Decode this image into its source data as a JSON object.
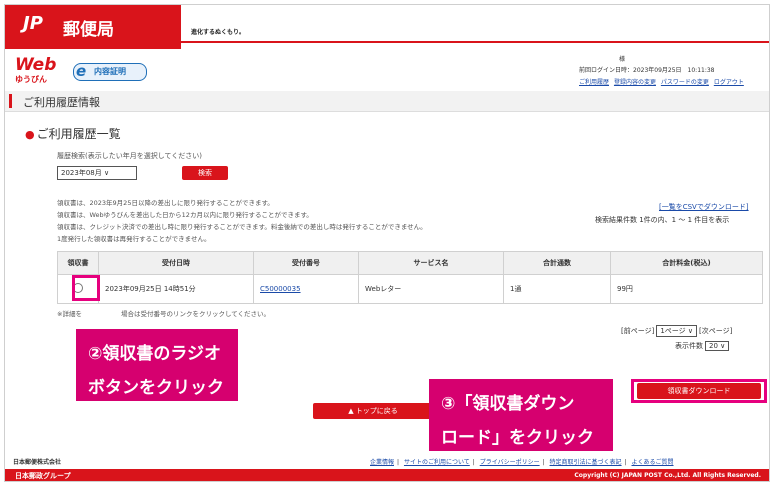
{
  "header": {
    "brand": "郵便局",
    "logo_mark": "JP",
    "slogan": "進化するぬくもり。",
    "web_logo": "Web",
    "web_logo_sub": "ゆうびん",
    "e_logo": "内容証明",
    "user_sama": "様",
    "last_login": "前回ログイン日時：2023年09月25日　10:11:38",
    "links": [
      "ご利用履歴",
      "登録内容の変更",
      "パスワードの変更",
      "ログアウト"
    ]
  },
  "page_title": "ご利用履歴情報",
  "section_title": "ご利用履歴一覧",
  "search": {
    "label": "履歴検索(表示したい年月を選択してください)",
    "month_value": "2023年08月 ∨",
    "button": "検索"
  },
  "notes": [
    "領収書は、2023年9月25日以降の差出しに限り発行することができます。",
    "領収書は、Webゆうびんを差出した日から12カ月以内に限り発行することができます。",
    "領収書は、クレジット決済での差出し時に限り発行することができます。料金後納での差出し時は発行することができません。",
    "1度発行した領収書は再発行することができません。"
  ],
  "csv_link": "[一覧をCSVでダウンロード]",
  "result_count": "検索結果件数 1件の内、1 ～ 1 件目を表示",
  "table": {
    "headers": [
      "領収書",
      "受付日時",
      "受付番号",
      "サービス名",
      "合計通数",
      "合計料金(税込)"
    ],
    "rows": [
      {
        "date": "2023年09月25日 14時51分",
        "number": "C50000035",
        "service": "Webレター",
        "count": "1通",
        "amount": "99円"
      }
    ]
  },
  "footnote": "※詳細を　　　　　　場合は受付番号のリンクをクリックしてください。",
  "pager": {
    "prev": "[前ページ]",
    "page_select": "1ページ ∨",
    "next": "[次ページ]",
    "per_page_label": "表示件数",
    "per_page_value": "20 ∨"
  },
  "buttons": {
    "download_receipt": "領収書ダウンロード",
    "back_top": "▲ トップに戻る"
  },
  "footer": {
    "company": "日本郵便株式会社",
    "links": [
      "企業情報",
      "サイトのご利用について",
      "プライバシーポリシー",
      "特定商取引法に基づく表記",
      "よくあるご質問"
    ],
    "group": "日本郵政グループ",
    "copyright": "Copyright (C) JAPAN POST Co.,Ltd. All Rights Reserved."
  },
  "annotations": {
    "step2_line1": "②領収書のラジオ",
    "step2_line2": "ボタンをクリック",
    "step3_line1": "③「領収書ダウン",
    "step3_line2": "ロード」をクリック"
  },
  "colors": {
    "brand_red": "#d9141b",
    "callout": "#d6006f",
    "link": "#1a4aa8"
  }
}
